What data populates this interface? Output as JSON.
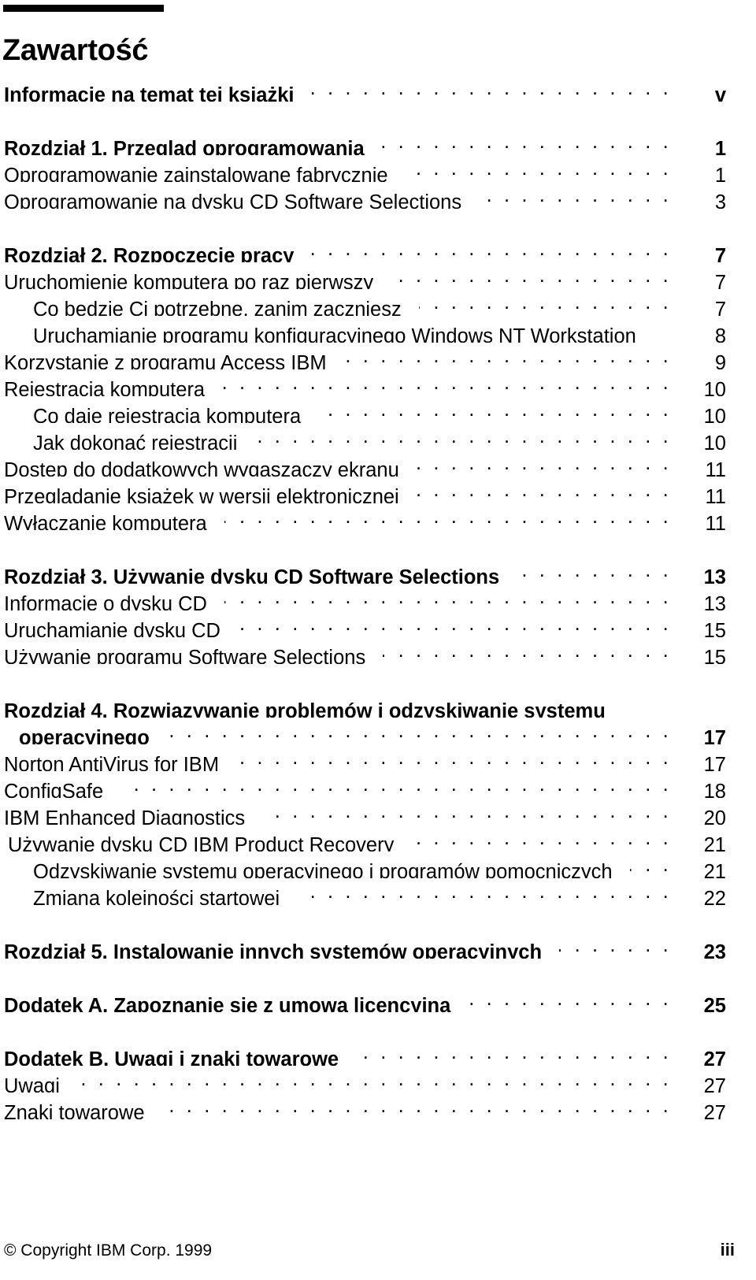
{
  "document": {
    "title": "Zawartość",
    "leader_char": "."
  },
  "toc": {
    "entries": [
      {
        "label": "Informacje na temat tej książki",
        "page": "v",
        "indent": 0,
        "bold": true,
        "leader": true,
        "space_before": false
      },
      {
        "label": "Rozdział 1.  Przegląd oprogramowania",
        "page": "1",
        "indent": 0,
        "bold": true,
        "leader": true,
        "space_before": true
      },
      {
        "label": "Oprogramowanie zainstalowane fabrycznie",
        "page": "1",
        "indent": 0,
        "bold": false,
        "leader": true,
        "space_before": false
      },
      {
        "label": "Oprogramowanie na dysku CD Software Selections",
        "page": "3",
        "indent": 0,
        "bold": false,
        "leader": true,
        "space_before": false
      },
      {
        "label": "Rozdział 2.  Rozpoczęcie pracy",
        "page": "7",
        "indent": 0,
        "bold": true,
        "leader": true,
        "space_before": true
      },
      {
        "label": "Uruchomienie komputera po raz pierwszy",
        "page": "7",
        "indent": 0,
        "bold": false,
        "leader": true,
        "space_before": false
      },
      {
        "label": "Co będzie Ci potrzebne, zanim zaczniesz",
        "page": "7",
        "indent": 1,
        "bold": false,
        "leader": true,
        "space_before": false
      },
      {
        "label": "Uruchamianie programu konfiguracyjnego Windows NT Workstation",
        "page": "8",
        "indent": 1,
        "bold": false,
        "leader": false,
        "space_before": false
      },
      {
        "label": "Korzystanie z programu Access IBM",
        "page": "9",
        "indent": 0,
        "bold": false,
        "leader": true,
        "space_before": false
      },
      {
        "label": "Rejestracja komputera",
        "page": "10",
        "indent": 0,
        "bold": false,
        "leader": true,
        "space_before": false
      },
      {
        "label": "Co daje rejestracja komputera",
        "page": "10",
        "indent": 1,
        "bold": false,
        "leader": true,
        "space_before": false
      },
      {
        "label": "Jak dokonać rejestracji",
        "page": "10",
        "indent": 1,
        "bold": false,
        "leader": true,
        "space_before": false
      },
      {
        "label": "Dostęp do dodatkowych wygaszaczy ekranu",
        "page": "11",
        "indent": 0,
        "bold": false,
        "leader": true,
        "space_before": false
      },
      {
        "label": "Przeglądanie książek w wersji elektronicznej",
        "page": "11",
        "indent": 0,
        "bold": false,
        "leader": true,
        "space_before": false
      },
      {
        "label": "Wyłączanie komputera",
        "page": "11",
        "indent": 0,
        "bold": false,
        "leader": true,
        "space_before": false
      },
      {
        "label": "Rozdział 3.  Używanie dysku CD Software Selections",
        "page": "13",
        "indent": 0,
        "bold": true,
        "leader": true,
        "space_before": true
      },
      {
        "label": "Informacje o dysku CD",
        "page": "13",
        "indent": 0,
        "bold": false,
        "leader": true,
        "space_before": false
      },
      {
        "label": "Uruchamianie dysku CD",
        "page": "15",
        "indent": 0,
        "bold": false,
        "leader": true,
        "space_before": false
      },
      {
        "label": "Używanie programu Software Selections",
        "page": "15",
        "indent": 0,
        "bold": false,
        "leader": true,
        "space_before": false
      },
      {
        "label": "Rozdział 4.  Rozwiązywanie problemów i odzyskiwanie systemu",
        "page": "",
        "indent": 0,
        "bold": true,
        "leader": false,
        "space_before": true
      },
      {
        "label": "operacyjnego",
        "page": "17",
        "indent": 2,
        "bold": true,
        "leader": true,
        "space_before": false
      },
      {
        "label": "Norton AntiVirus for IBM",
        "page": "17",
        "indent": 0,
        "bold": false,
        "leader": true,
        "space_before": false
      },
      {
        "label": "ConfigSafe",
        "page": "18",
        "indent": 0,
        "bold": false,
        "leader": true,
        "space_before": false
      },
      {
        "label": "IBM Enhanced Diagnostics",
        "page": "20",
        "indent": 0,
        "bold": false,
        "leader": true,
        "space_before": false
      },
      {
        "label": "Używanie dysku CD IBM Product Recovery",
        "page": "21",
        "indent": "h",
        "bold": false,
        "leader": true,
        "space_before": false
      },
      {
        "label": "Odzyskiwanie systemu operacyjnego i programów pomocniczych",
        "page": "21",
        "indent": 1,
        "bold": false,
        "leader": true,
        "space_before": false
      },
      {
        "label": "Zmiana kolejności startowej",
        "page": "22",
        "indent": 1,
        "bold": false,
        "leader": true,
        "space_before": false
      },
      {
        "label": "Rozdział 5.  Instalowanie innych systemów operacyjnych",
        "page": "23",
        "indent": 0,
        "bold": true,
        "leader": true,
        "space_before": true
      },
      {
        "label": "Dodatek A.  Zapoznanie się z umową licencyjną",
        "page": "25",
        "indent": 0,
        "bold": true,
        "leader": true,
        "space_before": true
      },
      {
        "label": "Dodatek B.  Uwagi i znaki towarowe",
        "page": "27",
        "indent": 0,
        "bold": true,
        "leader": true,
        "space_before": true
      },
      {
        "label": "Uwagi",
        "page": "27",
        "indent": 0,
        "bold": false,
        "leader": true,
        "space_before": false
      },
      {
        "label": "Znaki towarowe",
        "page": "27",
        "indent": 0,
        "bold": false,
        "leader": true,
        "space_before": false
      }
    ]
  },
  "footer": {
    "copyright": "© Copyright IBM Corp. 1999",
    "folio": "iii"
  }
}
